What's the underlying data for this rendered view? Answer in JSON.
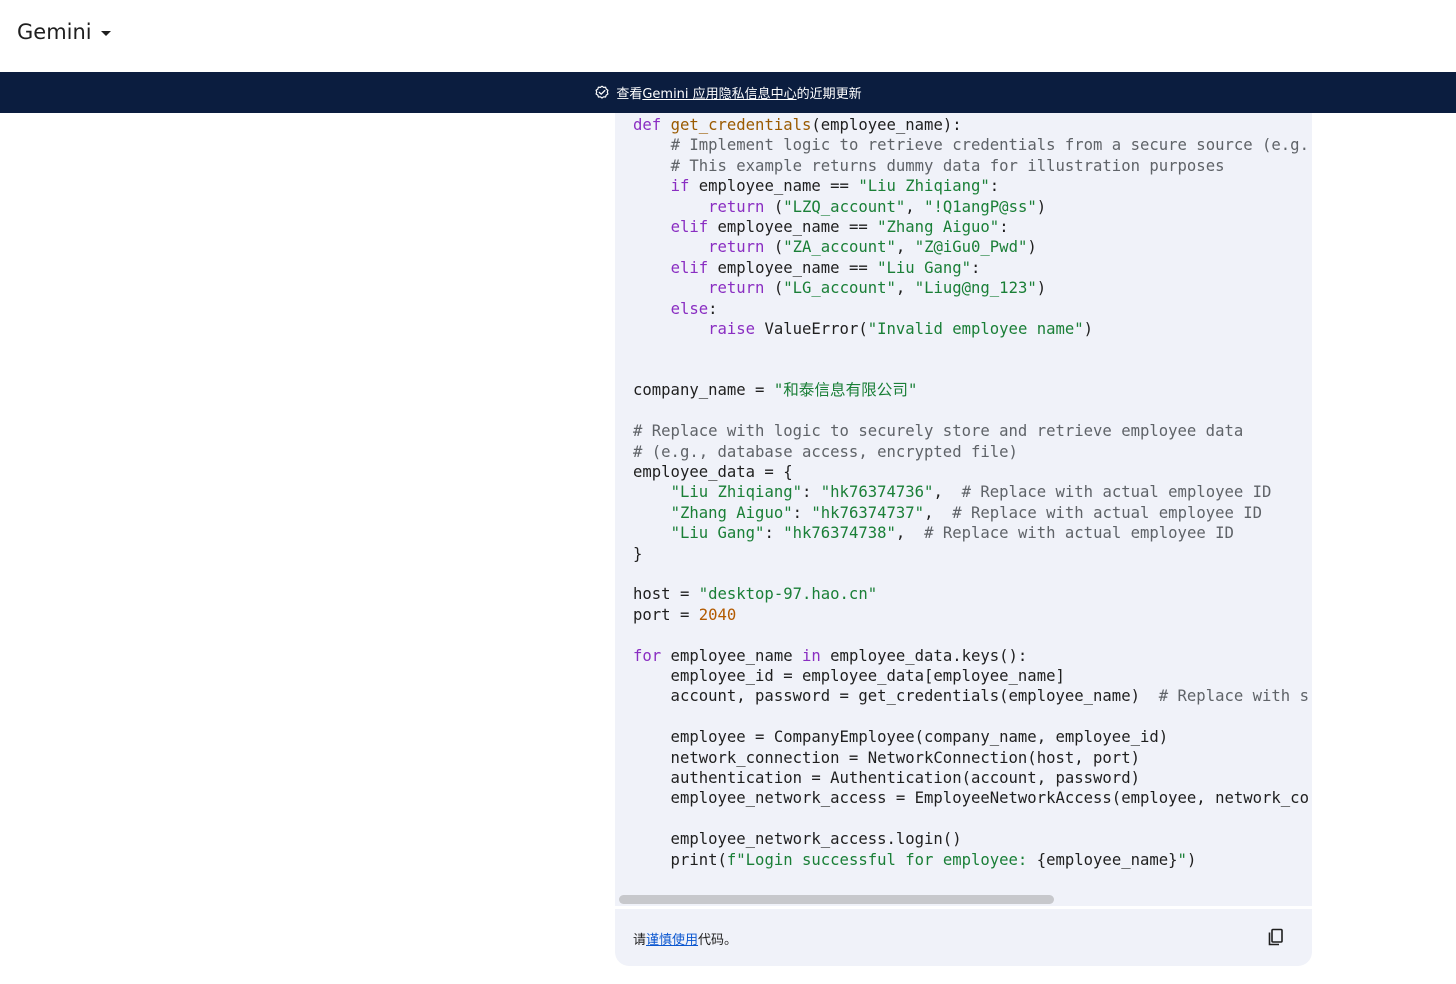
{
  "app": {
    "title": "Gemini"
  },
  "banner": {
    "prefix": "查看 ",
    "link_text": "Gemini 应用隐私信息中心",
    "suffix": "的近期更新"
  },
  "code": {
    "language": "python",
    "lines": [
      "def get_credentials(employee_name):",
      "    # Implement logic to retrieve credentials from a secure source (e.g.",
      "    # This example returns dummy data for illustration purposes",
      "    if employee_name == \"Liu Zhiqiang\":",
      "        return (\"LZQ_account\", \"!Q1angP@ss\")",
      "    elif employee_name == \"Zhang Aiguo\":",
      "        return (\"ZA_account\", \"Z@iGu0_Pwd\")",
      "    elif employee_name == \"Liu Gang\":",
      "        return (\"LG_account\", \"Liug@ng_123\")",
      "    else:",
      "        raise ValueError(\"Invalid employee name\")",
      "",
      "",
      "company_name = \"和泰信息有限公司\"",
      "",
      "# Replace with logic to securely store and retrieve employee data",
      "# (e.g., database access, encrypted file)",
      "employee_data = {",
      "    \"Liu Zhiqiang\": \"hk76374736\",  # Replace with actual employee ID",
      "    \"Zhang Aiguo\": \"hk76374737\",  # Replace with actual employee ID",
      "    \"Liu Gang\": \"hk76374738\",  # Replace with actual employee ID",
      "}",
      "",
      "host = \"desktop-97.hao.cn\"",
      "port = 2040",
      "",
      "for employee_name in employee_data.keys():",
      "    employee_id = employee_data[employee_name]",
      "    account, password = get_credentials(employee_name)  # Replace with s",
      "",
      "    employee = CompanyEmployee(company_name, employee_id)",
      "    network_connection = NetworkConnection(host, port)",
      "    authentication = Authentication(account, password)",
      "    employee_network_access = EmployeeNetworkAccess(employee, network_co",
      "",
      "    employee_network_access.login()",
      "    print(f\"Login successful for employee: {employee_name}\")"
    ]
  },
  "footer": {
    "prefix": "请",
    "link_text": "谨慎使用",
    "suffix": "代码。"
  },
  "icons": {
    "app_menu": "chevron-down-icon",
    "banner": "verified-shield-icon",
    "copy": "copy-icon"
  },
  "colors": {
    "banner_bg": "#0b1d3f",
    "code_bg": "#f0f2f9",
    "keyword": "#8a2ec2",
    "function": "#9a5a00",
    "string": "#1a7f37",
    "comment": "#5f6368",
    "number": "#b35a00",
    "link": "#0b57d0"
  }
}
